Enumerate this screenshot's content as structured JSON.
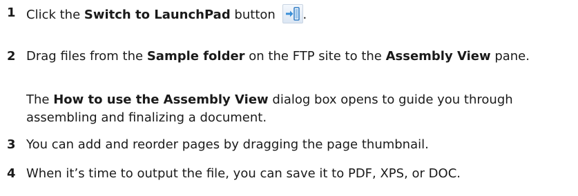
{
  "steps": [
    {
      "number": "1",
      "parts": {
        "a": "Click the ",
        "b": "Switch to LaunchPad",
        "c": " button",
        "d": "."
      },
      "icon": "switch-to-launchpad-icon"
    },
    {
      "number": "2",
      "parts": {
        "a": "Drag files from the ",
        "b": "Sample folder",
        "c": " on the FTP site to the ",
        "d": "Assembly View",
        "e": " pane."
      },
      "note": {
        "a": "The ",
        "b": "How to use the Assembly View",
        "c": " dialog box opens to guide you through assembling and finalizing a document."
      }
    },
    {
      "number": "3",
      "text": "You can add and reorder pages by dragging the page thumbnail."
    },
    {
      "number": "4",
      "text": "When it’s time to output the file, you can save it to PDF, XPS, or DOC."
    }
  ],
  "colors": {
    "icon_arrow": "#3a8fd8",
    "icon_panel": "#2f7bc4"
  }
}
